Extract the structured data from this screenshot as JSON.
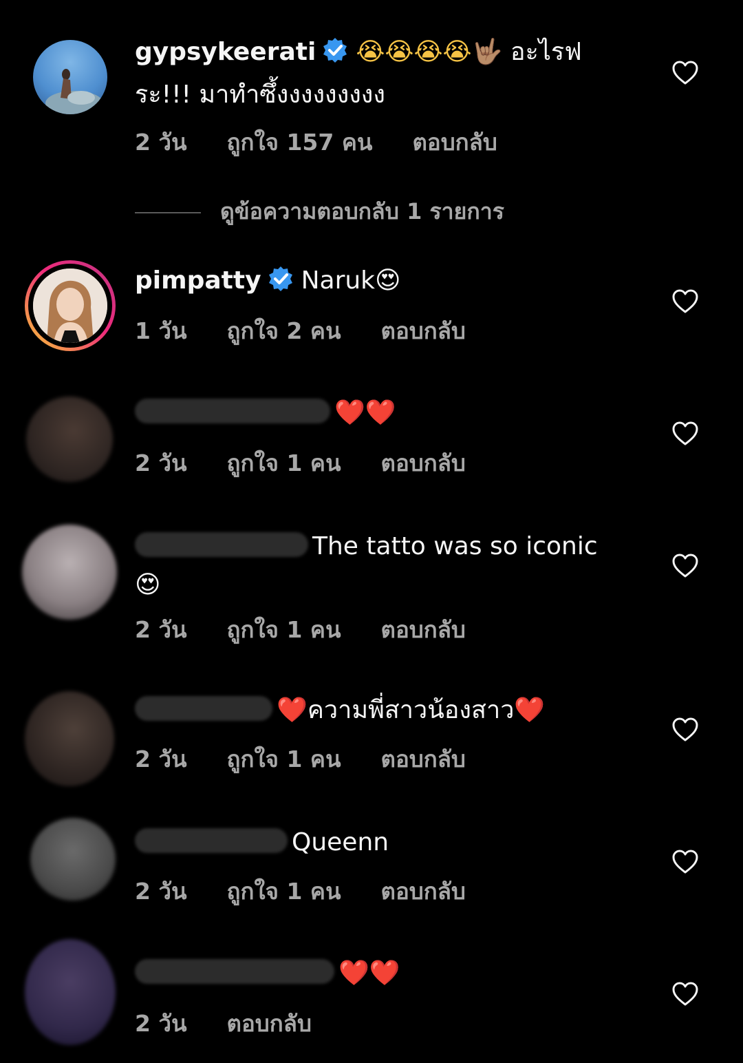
{
  "comments": [
    {
      "username": "gypsykeerati",
      "verified": true,
      "emoji_prefix": "😭😭😭😭🤟🏽",
      "text": "อะไรฟระ!!! มาทำซึ้งงงงงงงงง",
      "time": "2 วัน",
      "likes": "ถูกใจ 157 คน",
      "reply": "ตอบกลับ"
    },
    {
      "username": "pimpatty",
      "verified": true,
      "text": "Naruk😍",
      "time": "1 วัน",
      "likes": "ถูกใจ 2 คน",
      "reply": "ตอบกลับ"
    },
    {
      "text": "❤️❤️",
      "time": "2 วัน",
      "likes": "ถูกใจ 1 คน",
      "reply": "ตอบกลับ"
    },
    {
      "text": "The tatto was so iconic 😍",
      "time": "2 วัน",
      "likes": "ถูกใจ 1 คน",
      "reply": "ตอบกลับ"
    },
    {
      "text": "❤️ความพี่สาวน้องสาว❤️",
      "time": "2 วัน",
      "likes": "ถูกใจ 1 คน",
      "reply": "ตอบกลับ"
    },
    {
      "text": "Queenn",
      "time": "2 วัน",
      "likes": "ถูกใจ 1 คน",
      "reply": "ตอบกลับ"
    },
    {
      "text": "❤️❤️",
      "time": "2 วัน",
      "reply": "ตอบกลับ"
    }
  ],
  "view_replies": "ดูข้อความตอบกลับ 1 รายการ",
  "colors": {
    "background": "#000000",
    "primary_text": "#f5f5f5",
    "secondary_text": "#a8a8a8",
    "verified_blue": "#3897f0",
    "story_ring_start": "#f9ce34",
    "story_ring_end": "#c13584"
  }
}
